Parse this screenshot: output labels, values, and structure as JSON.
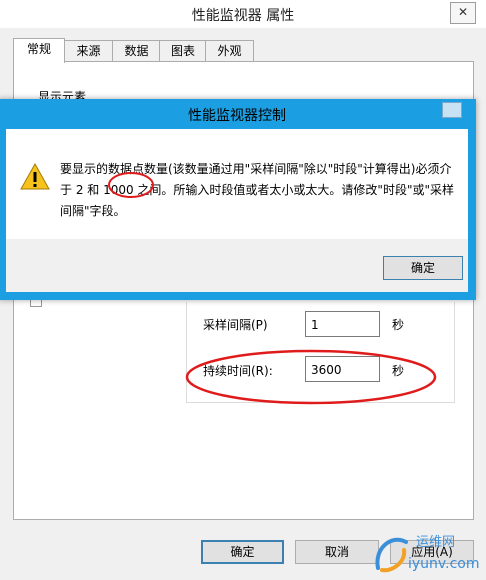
{
  "window": {
    "title": "性能监视器 属性",
    "close_glyph": "✕",
    "tabs": [
      "常规",
      "来源",
      "数据",
      "图表",
      "外观"
    ],
    "active_tab": 0,
    "section_label": "显示元素",
    "sample_interval_label": "采样间隔(P)",
    "sample_interval_value": "1",
    "sample_interval_unit": "秒",
    "duration_label": "持续时间(R):",
    "duration_value": "3600",
    "duration_unit": "秒",
    "buttons": {
      "ok": "确定",
      "cancel": "取消",
      "apply": "应用(A)"
    }
  },
  "dialog": {
    "title": "性能监视器控制",
    "icon": "warning-icon",
    "message": "要显示的数据点数量(该数量通过用\"采样间隔\"除以\"时段\"计算得出)必须介于 2 和 1000 之间。所输入时段值或者太小或太大。请修改\"时段\"或\"采样间隔\"字段。",
    "ok": "确定"
  },
  "watermark": {
    "line1": "运维网",
    "line2": "iyunv.com"
  },
  "colors": {
    "accent": "#1b9fe2",
    "annotation": "#e01b1b"
  }
}
